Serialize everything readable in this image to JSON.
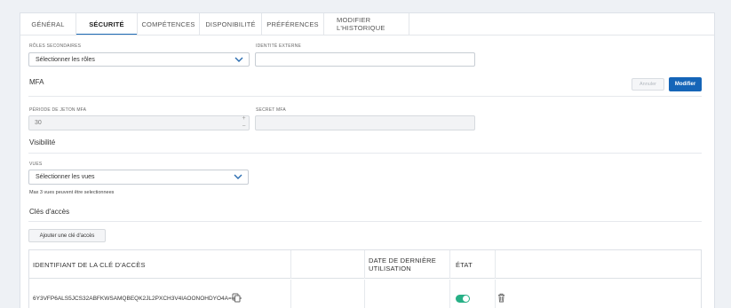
{
  "tabs": [
    {
      "label": "GÉNÉRAL",
      "active": false
    },
    {
      "label": "SÉCURITÉ",
      "active": true
    },
    {
      "label": "COMPÉTENCES",
      "active": false
    },
    {
      "label": "DISPONIBILITÉ",
      "active": false
    },
    {
      "label": "PRÉFÉRENCES",
      "active": false
    },
    {
      "label": "MODIFIER L'HISTORIQUE",
      "active": false
    }
  ],
  "roles": {
    "label": "RÔLES SECONDAIRES",
    "placeholder": "Sélectionner les rôles"
  },
  "external_id": {
    "label": "IDENTITÉ EXTERNE",
    "value": ""
  },
  "mfa": {
    "title": "MFA",
    "cancel_label": "Annuler",
    "modify_label": "Modifier",
    "token_period_label": "PÉRIODE DE JETON MFA",
    "token_period_value": "30",
    "secret_label": "SECRET MFA",
    "secret_value": ""
  },
  "visibility": {
    "title": "Visibilité",
    "views_label": "VUES",
    "views_placeholder": "Sélectionner les vues",
    "hint": "Max 3 vues peuvent être selectionnees"
  },
  "access_keys": {
    "title": "Clés d'accès",
    "add_label": "Ajouter une clé d'accès",
    "columns": [
      "IDENTIFIANT DE LA CLÉ D'ACCÈS",
      "",
      "DATE DE DERNIÈRE UTILISATION",
      "ÉTAT"
    ],
    "rows": [
      {
        "key_id": "6Y3VFP6ALS5JCS32ABFKWSAMQBEQK2JL2PXCH3V4IAOONOHDYO4A====",
        "last_used": "",
        "enabled": true
      }
    ]
  },
  "colors": {
    "accent": "#1565b8",
    "toggle_on": "#27b086"
  }
}
